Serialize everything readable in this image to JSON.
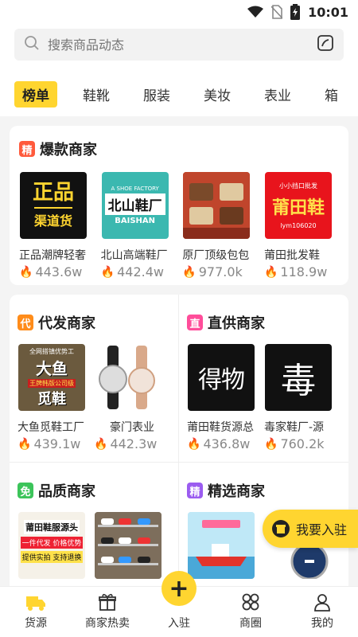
{
  "status": {
    "time": "10:01"
  },
  "search": {
    "placeholder": "搜索商品动态"
  },
  "tabs": [
    "榜单",
    "鞋靴",
    "服装",
    "美妆",
    "表业",
    "箱"
  ],
  "hot": {
    "badge": "精",
    "title": "爆款商家",
    "shops": [
      {
        "name": "正品潮牌轻奢",
        "value": "443.6w",
        "thumb_text": [
          "正品",
          "渠道货"
        ]
      },
      {
        "name": "北山高端鞋厂",
        "value": "442.4w",
        "thumb_text": [
          "A SHOE FACTORY",
          "北山鞋厂",
          "BAISHAN"
        ]
      },
      {
        "name": "原厂顶级包包",
        "value": "977.0k"
      },
      {
        "name": "莆田批发鞋",
        "value": "118.9w",
        "thumb_text": [
          "小小挡口批发",
          "莆田鞋",
          "lym106020"
        ]
      }
    ]
  },
  "sections": [
    {
      "badge": "代",
      "title": "代发商家",
      "shops": [
        {
          "name": "大鱼觅鞋工厂",
          "value": "439.1w",
          "thumb_text": [
            "全网搭镇优势工",
            "大鱼",
            "王牌韩版公司级",
            "觅鞋"
          ]
        },
        {
          "name": "豪门表业",
          "value": "442.3w"
        }
      ]
    },
    {
      "badge": "直",
      "title": "直供商家",
      "shops": [
        {
          "name": "莆田鞋货源总",
          "value": "436.8w",
          "thumb_text": [
            "得物"
          ]
        },
        {
          "name": "毒家鞋厂-源",
          "value": "760.2k",
          "thumb_text": [
            "毒"
          ]
        }
      ]
    },
    {
      "badge": "免",
      "title": "品质商家",
      "shops": [
        {
          "thumb_text": [
            "莆田鞋服源头",
            "一件代发 价格优势",
            "提供实拍 支持退换"
          ]
        },
        {}
      ]
    },
    {
      "badge": "精",
      "title": "精选商家",
      "shops": [
        {},
        {}
      ]
    }
  ],
  "float_button": {
    "label": "我要入驻"
  },
  "nav": [
    "货源",
    "商家热卖",
    "入驻",
    "商圈",
    "我的"
  ],
  "colors": {
    "accent": "#ffd530",
    "flame": "#ff3a2f"
  }
}
